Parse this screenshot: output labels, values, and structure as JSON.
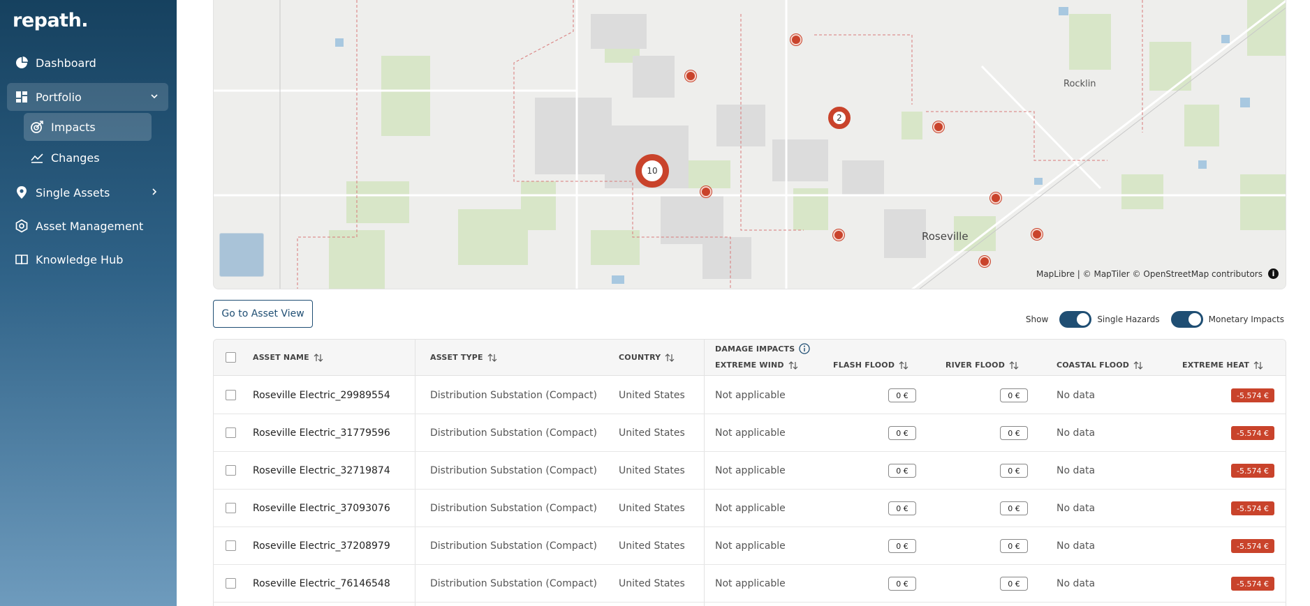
{
  "app": {
    "logo": "repath."
  },
  "sidebar": {
    "items": [
      {
        "label": "Dashboard"
      },
      {
        "label": "Portfolio"
      },
      {
        "label": "Impacts"
      },
      {
        "label": "Changes"
      },
      {
        "label": "Single Assets"
      },
      {
        "label": "Asset Management"
      },
      {
        "label": "Knowledge Hub"
      }
    ]
  },
  "map": {
    "places": [
      "Rocklin",
      "Roseville"
    ],
    "clusters": [
      "10",
      "2"
    ],
    "attribution": "MapLibre | © MapTiler © OpenStreetMap contributors",
    "info_glyph": "i"
  },
  "toolbar": {
    "asset_view_button": "Go to Asset View",
    "show_label": "Show",
    "toggle_single_hazards": "Single Hazards",
    "toggle_monetary_impacts": "Monetary Impacts"
  },
  "table": {
    "columns": {
      "asset_name": "ASSET NAME",
      "asset_type": "ASSET TYPE",
      "country": "COUNTRY",
      "damage_impacts": "DAMAGE IMPACTS",
      "extreme_wind": "EXTREME WIND",
      "flash_flood": "FLASH FLOOD",
      "river_flood": "RIVER FLOOD",
      "coastal_flood": "COASTAL FLOOD",
      "extreme_heat": "EXTREME HEAT"
    },
    "rows": [
      {
        "name": "Roseville Electric_29989554",
        "type": "Distribution Substation (Compact)",
        "country": "United States",
        "wind": "Not applicable",
        "flash": "0 €",
        "river": "0 €",
        "coastal": "No data",
        "heat": "-5.574 €"
      },
      {
        "name": "Roseville Electric_31779596",
        "type": "Distribution Substation (Compact)",
        "country": "United States",
        "wind": "Not applicable",
        "flash": "0 €",
        "river": "0 €",
        "coastal": "No data",
        "heat": "-5.574 €"
      },
      {
        "name": "Roseville Electric_32719874",
        "type": "Distribution Substation (Compact)",
        "country": "United States",
        "wind": "Not applicable",
        "flash": "0 €",
        "river": "0 €",
        "coastal": "No data",
        "heat": "-5.574 €"
      },
      {
        "name": "Roseville Electric_37093076",
        "type": "Distribution Substation (Compact)",
        "country": "United States",
        "wind": "Not applicable",
        "flash": "0 €",
        "river": "0 €",
        "coastal": "No data",
        "heat": "-5.574 €"
      },
      {
        "name": "Roseville Electric_37208979",
        "type": "Distribution Substation (Compact)",
        "country": "United States",
        "wind": "Not applicable",
        "flash": "0 €",
        "river": "0 €",
        "coastal": "No data",
        "heat": "-5.574 €"
      },
      {
        "name": "Roseville Electric_76146548",
        "type": "Distribution Substation (Compact)",
        "country": "United States",
        "wind": "Not applicable",
        "flash": "0 €",
        "river": "0 €",
        "coastal": "No data",
        "heat": "-5.574 €"
      }
    ]
  },
  "colors": {
    "sidebar_top": "#16415f",
    "accent": "#1f4e73",
    "negative": "#c9432b"
  },
  "icons": [
    "dashboard-icon",
    "portfolio-icon",
    "impacts-icon",
    "changes-icon",
    "location-pin-icon",
    "gear-icon",
    "book-icon",
    "chevron-down-icon",
    "chevron-right-icon",
    "info-icon",
    "sort-icon"
  ]
}
